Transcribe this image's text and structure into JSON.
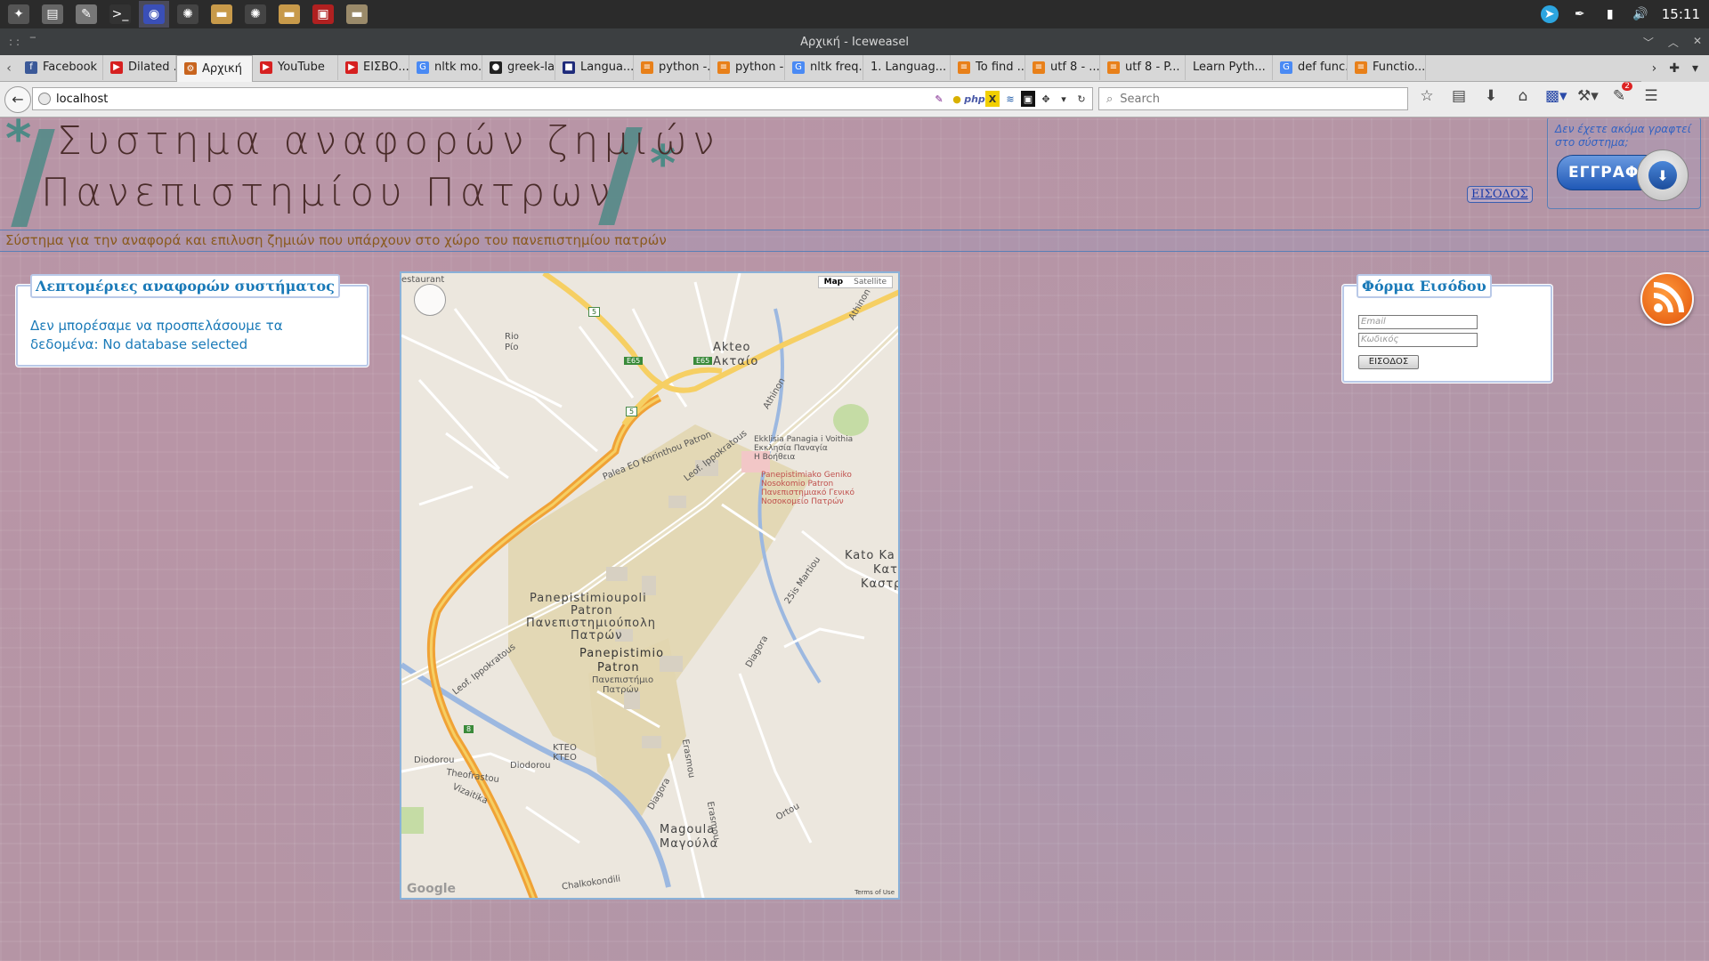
{
  "taskbar": {
    "apps": [
      {
        "name": "app-launcher-icon",
        "glyph": "✦",
        "color": "#555"
      },
      {
        "name": "window-list-icon",
        "glyph": "▤",
        "color": "#666"
      },
      {
        "name": "text-editor-icon",
        "glyph": "✎",
        "color": "#777"
      },
      {
        "name": "terminal-icon",
        "glyph": ">_",
        "color": "#333"
      },
      {
        "name": "browser-icon",
        "glyph": "◉",
        "color": "#3a4fb8"
      },
      {
        "name": "spider-icon",
        "glyph": "✺",
        "color": "#444"
      },
      {
        "name": "folder-icon",
        "glyph": "▬",
        "color": "#c89a4a"
      },
      {
        "name": "spider-icon-2",
        "glyph": "✺",
        "color": "#444"
      },
      {
        "name": "folder-icon-2",
        "glyph": "▬",
        "color": "#c89a4a"
      },
      {
        "name": "media-icon",
        "glyph": "▣",
        "color": "#b02020"
      },
      {
        "name": "folder-icon-3",
        "glyph": "▬",
        "color": "#9a8a6a"
      }
    ],
    "clock": "15:11"
  },
  "window": {
    "title": "Αρχική - Iceweasel"
  },
  "tabs": [
    {
      "label": "Facebook",
      "icon": "facebook-icon",
      "icon_color": "#3b5998",
      "icon_glyph": "f",
      "active": false
    },
    {
      "label": "Dilated ...",
      "icon": "youtube-icon",
      "icon_color": "#d62020",
      "icon_glyph": "▶",
      "active": false
    },
    {
      "label": "Αρχική",
      "icon": "site-icon",
      "icon_color": "#c8641e",
      "icon_glyph": "⚙",
      "active": true
    },
    {
      "label": "YouTube",
      "icon": "youtube-icon",
      "icon_color": "#d62020",
      "icon_glyph": "▶",
      "active": false
    },
    {
      "label": "ΕΙΣΒΟ...",
      "icon": "youtube-icon",
      "icon_color": "#d62020",
      "icon_glyph": "▶",
      "active": false
    },
    {
      "label": "nltk mo...",
      "icon": "google-icon",
      "icon_color": "#4a8af4",
      "icon_glyph": "G",
      "active": false
    },
    {
      "label": "greek-la...",
      "icon": "github-icon",
      "icon_color": "#222",
      "icon_glyph": "●",
      "active": false
    },
    {
      "label": "Langua...",
      "icon": "site-icon",
      "icon_color": "#1e2a7a",
      "icon_glyph": "■",
      "active": false
    },
    {
      "label": "python -...",
      "icon": "stackoverflow-icon",
      "icon_color": "#e8801a",
      "icon_glyph": "≡",
      "active": false
    },
    {
      "label": "python -...",
      "icon": "stackoverflow-icon",
      "icon_color": "#e8801a",
      "icon_glyph": "≡",
      "active": false
    },
    {
      "label": "nltk freq...",
      "icon": "google-icon",
      "icon_color": "#4a8af4",
      "icon_glyph": "G",
      "active": false
    },
    {
      "label": "1. Languag...",
      "icon": "",
      "icon_color": "",
      "icon_glyph": "",
      "active": false
    },
    {
      "label": "To find ...",
      "icon": "stackoverflow-icon",
      "icon_color": "#e8801a",
      "icon_glyph": "≡",
      "active": false
    },
    {
      "label": "utf 8 - ...",
      "icon": "stackoverflow-icon",
      "icon_color": "#e8801a",
      "icon_glyph": "≡",
      "active": false
    },
    {
      "label": "utf 8 - P...",
      "icon": "stackoverflow-icon",
      "icon_color": "#e8801a",
      "icon_glyph": "≡",
      "active": false
    },
    {
      "label": "Learn Pyth...",
      "icon": "",
      "icon_color": "",
      "icon_glyph": "",
      "active": false
    },
    {
      "label": "def func...",
      "icon": "google-icon",
      "icon_color": "#4a8af4",
      "icon_glyph": "G",
      "active": false
    },
    {
      "label": "Functio...",
      "icon": "stackoverflow-icon",
      "icon_color": "#e8801a",
      "icon_glyph": "≡",
      "active": false
    }
  ],
  "navbar": {
    "url": "localhost",
    "search_placeholder": "Search"
  },
  "site": {
    "title_line1": "Συστημα αναφορών ζημιών",
    "title_line2": "Πανεπιστημίου Πατρων",
    "login_link": "ΕΙΣΟΔΟΣ",
    "register_prompt": "Δεν έχετε ακόμα γραφτεί στο σύστημα;",
    "register_button": "ΕΓΓΡΑΦΗ",
    "tagline": "Σύστημα για την αναφορά και επιλυση ζημιών που υπάρχουν στο χώρο του πανεπιστημίου πατρών",
    "details_title": "Λεπτομέριες αναφορών συστήματος",
    "details_message": "Δεν μπορέσαμε να προσπελάσουμε τα δεδομένα: No database selected",
    "login_form_title": "Φόρμα Εισόδου",
    "email_placeholder": "Email",
    "password_placeholder": "Κωδικός",
    "login_submit": "ΕΙΣΟΔΟΣ"
  },
  "map": {
    "type_map": "Map",
    "type_satellite": "Satellite",
    "google": "Google",
    "terms": "Terms of Use",
    "labels": {
      "akteo": "Akteo",
      "aktaio": "Ακταίο",
      "rio": "Rio",
      "rio_gr": "Ρίο",
      "panagia": "Ekklisia Panagia i Voithia",
      "panagia_gr": "Εκκλησία Παναγία",
      "voitheia_gr": "Η Βοήθεια",
      "hospital": "Panepistimiako Geniko",
      "hospital2": "Nosokomio Patron",
      "hospital_gr": "Πανεπιστημιακό Γενικό",
      "hospital_gr2": "Νοσοκομείο Πατρών",
      "uni_city": "Panepistimioupoli",
      "uni_city2": "Patron",
      "uni_city_gr": "Πανεπιστημιούπολη",
      "uni_city_gr2": "Πατρών",
      "uni": "Panepistimio",
      "uni2": "Patron",
      "uni_gr": "Πανεπιστήμιο",
      "uni_gr2": "Πατρών",
      "kato": "Kato Ka",
      "kato2": "Κατ",
      "kato3": "Καστρ",
      "ktel": "ΚΤΕΟ",
      "ktel2": "ΚΤΕΟ",
      "diodorou": "Diodorou",
      "diodorou2": "Diodorou",
      "magoula": "Magoula",
      "magoula_gr": "Μαγούλα",
      "ippokratous": "Leof. Ippokratous",
      "ippokratous2": "Leof. Ippokratous",
      "patron": "Palea EO Korinthou Patron",
      "athinon": "Athinon",
      "athinon2": "Athinon",
      "restaurant": "estaurant",
      "ortou": "Ortou",
      "diagora": "Diagora",
      "diagora2": "Diagora",
      "erasmou": "Erasmou",
      "erasmou2": "Erasmou",
      "chalkokondili": "Chalkokondili",
      "theofrastou": "Theofrastou",
      "vizaitika": "Vizaitika",
      "sorimaiou": "25is Martiou",
      "r5": "5",
      "r5b": "5",
      "e65": "E65",
      "e65b": "E65",
      "r8": "8"
    }
  }
}
